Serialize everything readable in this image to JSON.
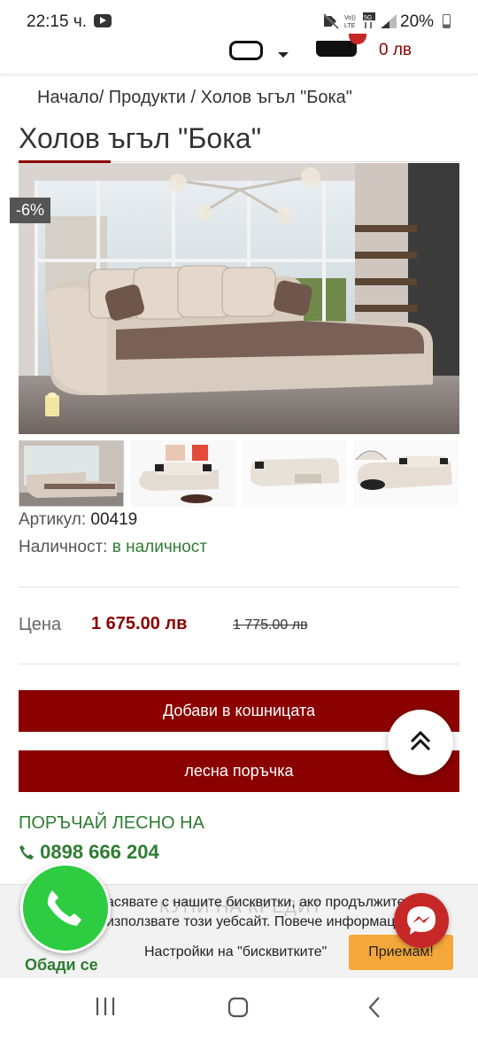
{
  "status_bar": {
    "time": "22:15 ч.",
    "battery": "20%",
    "network_labels": [
      "Vo)) LTE",
      "5G"
    ]
  },
  "header": {
    "cart_total": "0 лв"
  },
  "breadcrumb": "Начало/ Продукти / Холов ъгъл \"Бока\"",
  "product": {
    "title": "Холов ъгъл \"Бока\"",
    "discount": "-6%",
    "sku_label": "Артикул:",
    "sku_value": "00419",
    "stock_label": "Наличност:",
    "stock_value": "в наличност",
    "price_label": "Цена",
    "price_current": "1 675.00 лв",
    "price_old": "1 775.00 лв"
  },
  "buttons": {
    "add_to_cart": "Добави в кошницата",
    "easy_order": "лесна поръчка"
  },
  "contact": {
    "order_easy_heading": "ПОРЪЧАЙ ЛЕСНО НА",
    "phone": "0898 666 204",
    "call_label": "Обади се"
  },
  "cookie": {
    "text": "асявате с нашите бисквитки, ако продължите да използвате този уебсайт. Повече информация",
    "settings": "Настройки на \"бисквитките\"",
    "accept": "Приемам!",
    "ghost_text": "КУПИ НА КРЕДИТ"
  },
  "colors": {
    "brand_red": "#8b0000",
    "green": "#2e7d32",
    "accept_orange": "#f5a83a"
  }
}
